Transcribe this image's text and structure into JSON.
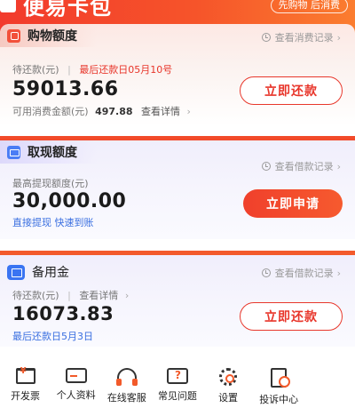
{
  "header": {
    "title": "便易卡包",
    "slogan": "先购物 后消费"
  },
  "shopping": {
    "title": "购物额度",
    "record_link": "查看消费记录",
    "due_label": "待还款(元)",
    "last_date": "最后还款日05月10号",
    "amount": "59013.66",
    "available_label": "可用消费金额(元)",
    "available_value": "497.88",
    "detail_link": "查看详情",
    "button": "立即还款"
  },
  "cash": {
    "title": "取现额度",
    "record_link": "查看借款记录",
    "max_label": "最高提现额度(元)",
    "amount": "30,000.00",
    "promo": "直接提现 快速到账",
    "button": "立即申请"
  },
  "reserve": {
    "title": "备用金",
    "record_link": "查看借款记录",
    "due_label": "待还款(元)",
    "detail_link": "查看详情",
    "amount": "16073.83",
    "last_date": "最后还款日5月3日",
    "button": "立即还款"
  },
  "grid": [
    {
      "label": "开发票",
      "icon": "invoice-icon"
    },
    {
      "label": "个人资料",
      "icon": "id-card-icon"
    },
    {
      "label": "在线客服",
      "icon": "headset-icon"
    },
    {
      "label": "常见问题",
      "icon": "faq-icon"
    },
    {
      "label": "设置",
      "icon": "gear-icon"
    },
    {
      "label": "投诉中心",
      "icon": "complaint-icon"
    }
  ],
  "colors": {
    "brand_red": "#f0402c",
    "link_blue": "#3a6fe0"
  }
}
